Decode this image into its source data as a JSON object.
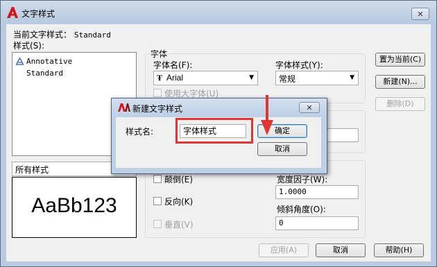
{
  "window": {
    "title": "文字样式",
    "close_label": "✕"
  },
  "current_style": {
    "label": "当前文字样式：",
    "value": "Standard"
  },
  "styles_list": {
    "label": "样式(S):",
    "items": [
      {
        "name": "Annotative",
        "annotative": true
      },
      {
        "name": "Standard",
        "annotative": false
      }
    ]
  },
  "filter_combo": {
    "value": "所有样式"
  },
  "preview": {
    "text": "AaBb123"
  },
  "font_group": {
    "title": "字体",
    "font_name_label": "字体名(F):",
    "font_name_value": "Arial",
    "font_style_label": "字体样式(Y):",
    "font_style_value": "常规",
    "bigfont_label": "使用大字体(U)"
  },
  "effects": {
    "upside_down_label": "颠倒(E)",
    "backwards_label": "反向(K)",
    "vertical_label": "垂直(V)",
    "width_factor_label": "宽度因子(W):",
    "width_factor_value": "1.0000",
    "oblique_label": "倾斜角度(O):",
    "oblique_value": "0"
  },
  "buttons": {
    "set_current": "置为当前(C)",
    "new": "新建(N)...",
    "delete": "删除(D)",
    "apply": "应用(A)",
    "cancel": "取消",
    "help": "帮助(H)"
  },
  "new_style_dialog": {
    "title": "新建文字样式",
    "name_label": "样式名:",
    "name_value": "字体样式",
    "ok": "确定",
    "cancel": "取消"
  },
  "colors": {
    "highlight_red": "#e33434",
    "autocad_red": "#d2161c"
  }
}
